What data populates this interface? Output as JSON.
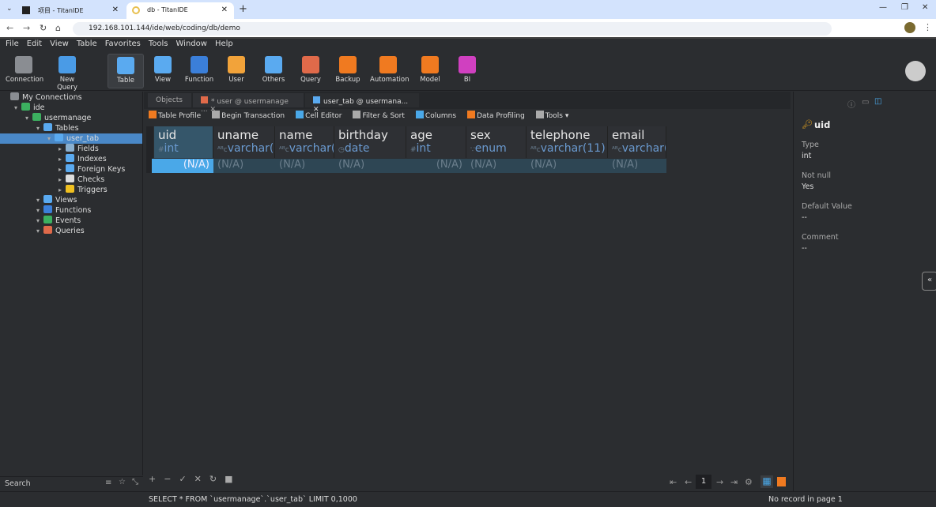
{
  "browser": {
    "tabs": [
      {
        "label": "项目 - TitanIDE"
      },
      {
        "label": "db - TitanIDE"
      }
    ],
    "url": "192.168.101.144/ide/web/coding/db/demo"
  },
  "menu": [
    "File",
    "Edit",
    "View",
    "Table",
    "Favorites",
    "Tools",
    "Window",
    "Help"
  ],
  "toolbar": [
    {
      "label": "Connection",
      "color": "#8a8d92"
    },
    {
      "label": "New Query",
      "color": "#4a9be6"
    },
    {
      "label": "Table",
      "color": "#5aaaf0"
    },
    {
      "label": "View",
      "color": "#5aaaf0"
    },
    {
      "label": "Function",
      "color": "#3b7fd9"
    },
    {
      "label": "User",
      "color": "#f2a33a"
    },
    {
      "label": "Others",
      "color": "#5aaaf0"
    },
    {
      "label": "Query",
      "color": "#e06a4a"
    },
    {
      "label": "Backup",
      "color": "#f07a20"
    },
    {
      "label": "Automation",
      "color": "#f07a20"
    },
    {
      "label": "Model",
      "color": "#f07a20"
    },
    {
      "label": "BI",
      "color": "#d040c0"
    }
  ],
  "sidebar": {
    "tree": [
      {
        "label": "My Connections",
        "level": 0,
        "color": "#8a8d92"
      },
      {
        "label": "ide",
        "level": 1,
        "color": "#3cb060"
      },
      {
        "label": "usermanage",
        "level": 2,
        "color": "#3cb060"
      },
      {
        "label": "Tables",
        "level": 3,
        "color": "#5aaaf0"
      },
      {
        "label": "user_tab",
        "level": 4,
        "color": "#5aaaf0",
        "selected": true
      },
      {
        "label": "Fields",
        "level": 5,
        "color": "#8ab0d0"
      },
      {
        "label": "Indexes",
        "level": 5,
        "color": "#5aaaf0"
      },
      {
        "label": "Foreign Keys",
        "level": 5,
        "color": "#5aaaf0"
      },
      {
        "label": "Checks",
        "level": 5,
        "color": "#ddd"
      },
      {
        "label": "Triggers",
        "level": 5,
        "color": "#f0c020"
      },
      {
        "label": "Views",
        "level": 3,
        "color": "#5aaaf0"
      },
      {
        "label": "Functions",
        "level": 3,
        "color": "#3b7fd9"
      },
      {
        "label": "Events",
        "level": 3,
        "color": "#3cb060"
      },
      {
        "label": "Queries",
        "level": 3,
        "color": "#e06a4a"
      }
    ],
    "search_placeholder": "Search"
  },
  "editor": {
    "tabs": [
      {
        "label": "Objects"
      },
      {
        "label": "* user @ usermanage ..."
      },
      {
        "label": "user_tab @ usermana..."
      }
    ],
    "actions": [
      "Table Profile",
      "Begin Transaction",
      "Cell Editor",
      "Filter & Sort",
      "Columns",
      "Data Profiling",
      "Tools"
    ],
    "columns": [
      {
        "name": "uid",
        "type": "int",
        "icon": "#"
      },
      {
        "name": "uname",
        "type": "varchar(",
        "icon": "ᴬᴮc"
      },
      {
        "name": "name",
        "type": "varchar(",
        "icon": "ᴬᴮc"
      },
      {
        "name": "birthday",
        "type": "date",
        "icon": "◷"
      },
      {
        "name": "age",
        "type": "int",
        "icon": "#"
      },
      {
        "name": "sex",
        "type": "enum",
        "icon": "∵"
      },
      {
        "name": "telephone",
        "type": "varchar(11)",
        "icon": "ᴬᴮc"
      },
      {
        "name": "email",
        "type": "varchar(",
        "icon": "ᴬᴮc"
      }
    ],
    "row": [
      "(N/A)",
      "(N/A)",
      "(N/A)",
      "(N/A)",
      "(N/A)",
      "(N/A)",
      "(N/A)",
      "(N/A)"
    ],
    "page": "1"
  },
  "inspector": {
    "field": "uid",
    "type_label": "Type",
    "type": "int",
    "notnull_label": "Not null",
    "notnull": "Yes",
    "default_label": "Default Value",
    "default": "--",
    "comment_label": "Comment",
    "comment": "--"
  },
  "status": {
    "sql": "SELECT * FROM `usermanage`.`user_tab` LIMIT 0,1000",
    "info": "No record in page 1"
  }
}
